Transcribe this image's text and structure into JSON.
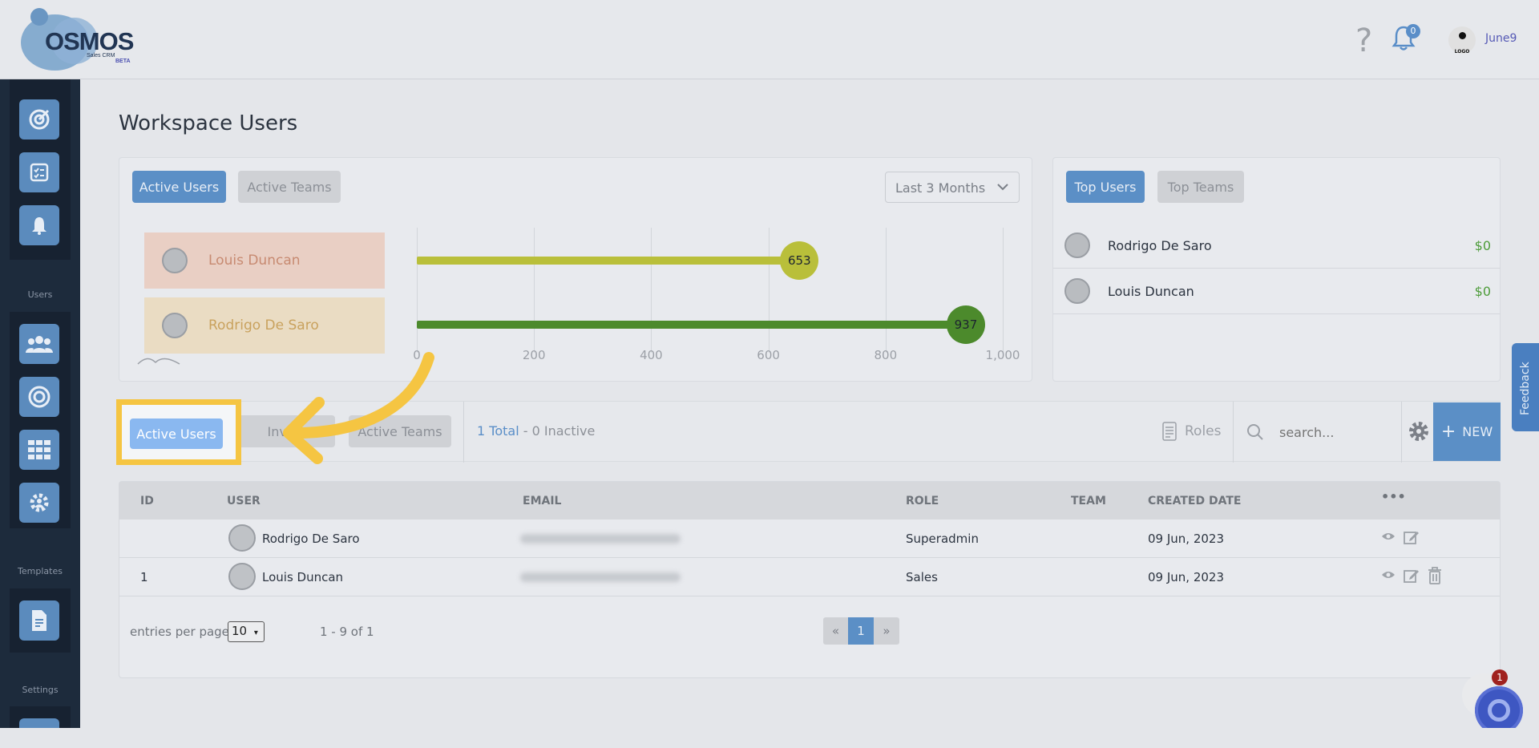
{
  "header": {
    "logo_text": "OSMOS",
    "logo_sub": "Sales CRM",
    "logo_beta": "BETA",
    "help_icon": "?",
    "notifications_count": "0",
    "avatar_logo_text": "LOGO",
    "user_name": "June9"
  },
  "sidebar": {
    "sections": [
      "Users",
      "Templates",
      "Settings"
    ]
  },
  "page": {
    "title": "Workspace Users"
  },
  "activity_card": {
    "tabs": [
      "Active Users",
      "Active Teams"
    ],
    "period": "Last 3 Months",
    "rows": [
      {
        "name": "Louis Duncan"
      },
      {
        "name": "Rodrigo De Saro"
      }
    ]
  },
  "chart_data": {
    "type": "bar",
    "orientation": "horizontal",
    "categories": [
      "Louis Duncan",
      "Rodrigo De Saro"
    ],
    "values": [
      653,
      937
    ],
    "xlim": [
      0,
      1000
    ],
    "xticks": [
      "0",
      "200",
      "400",
      "600",
      "800",
      "1,000"
    ],
    "colors": [
      "#b9bf3a",
      "#4c8a2c"
    ],
    "grid": "vertical"
  },
  "top_card": {
    "tabs": [
      "Top Users",
      "Top Teams"
    ],
    "rows": [
      {
        "name": "Rodrigo De Saro",
        "amount": "$0"
      },
      {
        "name": "Louis Duncan",
        "amount": "$0"
      }
    ]
  },
  "toolbar": {
    "tabs": [
      "Active Users",
      "Invite",
      "Active Teams"
    ],
    "total": "1 Total",
    "separator": " - ",
    "inactive": "0 Inactive",
    "roles_label": "Roles",
    "search_placeholder": "search...",
    "new_label": "NEW"
  },
  "table": {
    "headers": [
      "ID",
      "USER",
      "EMAIL",
      "ROLE",
      "TEAM",
      "CREATED DATE"
    ],
    "rows": [
      {
        "id": "",
        "user": "Rodrigo De Saro",
        "role": "Superadmin",
        "team": "",
        "created": "09 Jun, 2023"
      },
      {
        "id": "1",
        "user": "Louis Duncan",
        "role": "Sales",
        "team": "",
        "created": "09 Jun, 2023"
      }
    ],
    "more_icon": "•••"
  },
  "footer": {
    "entries_label": "entries per page",
    "per_page": "10",
    "range": "1 - 9 of 1",
    "pager": [
      "«",
      "1",
      "»"
    ]
  },
  "feedback_label": "Feedback",
  "chat_badge": "1",
  "highlight": {
    "label": "Active Users"
  },
  "colors": {
    "accent": "#5b8fc6",
    "sidebar": "#1d2b3c",
    "highlight": "#f5c542"
  }
}
